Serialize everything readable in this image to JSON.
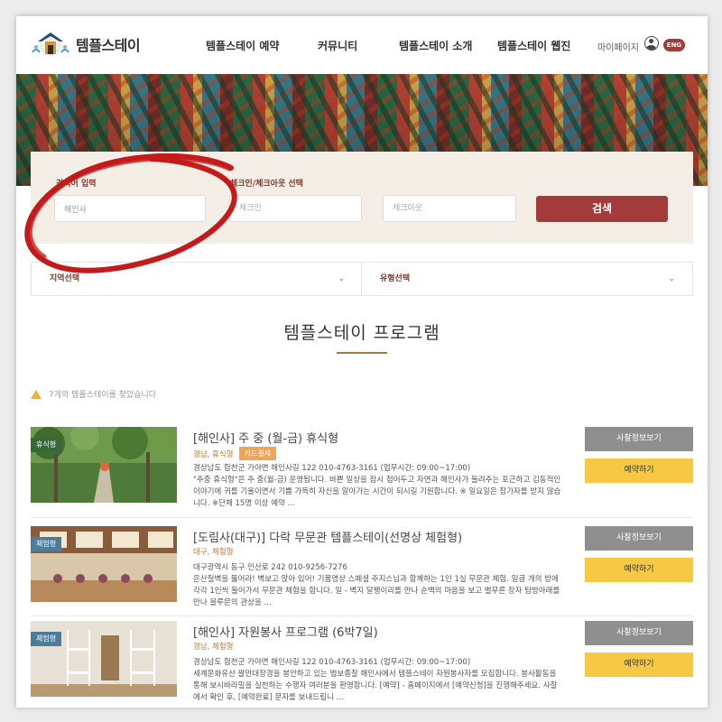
{
  "header": {
    "logo_text": "템플스테이",
    "nav": [
      "템플스테이 예약",
      "커뮤니티",
      "템플스테이 소개",
      "템플스테이 웹진"
    ],
    "mypage": "마이페이지",
    "lang": "ENG"
  },
  "search": {
    "keyword_label": "검색어 입력",
    "keyword_value": "해인사",
    "date_label": "체크인/체크아웃 선택",
    "checkin_placeholder": "체크인",
    "checkout_placeholder": "체크아웃",
    "button": "검색"
  },
  "filters": {
    "region": "지역선택",
    "type": "유형선택"
  },
  "section_title": "템플스테이 프로그램",
  "notice": "7개의 템플스테이를 찾았습니다",
  "programs": [
    {
      "tag": "휴식형",
      "title": "[해인사] 주 중 (월-금) 휴식형",
      "meta": "경남, 휴식형",
      "badge": "카드결제",
      "address": "경상남도 합천군 가야면 해인사길 122 010-4763-3161 (업무시간: 09:00~17:00)",
      "desc": "\"주중 휴식형\"은 주 중(월-금) 운영됩니다. 바쁜 일상을 잠시 접어두고 자연과 해인사가 들려주는 포근하고 김동적인 이야기에 귀를 기울이면서 기쁨 가득히 자신을 알아가는 시간이 되시길 기원합니다. ※ 일요일은 참가자를 받지 않습니다. ※단체 15명 이상 예약 ...",
      "info_btn": "사찰정보보기",
      "book_btn": "예약하기"
    },
    {
      "tag": "체험형",
      "title": "[도림사(대구)] 다락 무문관 템플스테이(선명상 체험형)",
      "meta": "대구, 체험형",
      "badge": "",
      "address": "대구광역시 동구 인산로 242 010-9256-7276",
      "desc": "은산철벽을 뚫어라! 벽보고 앉아 있어! 기몸명상 스페셜 주지스님과 함께하는 1인 1실 무문관 체험. 일곱 개의 방에 각각 1인씩 들어가서 무문관 체험을 합니다. 일 - 벽지 달팽이리를 만나 순백의 마음을 보고 별무른 장자 탐방아래를 만나 블루문의 관상을 ...",
      "info_btn": "사찰정보보기",
      "book_btn": "예약하기"
    },
    {
      "tag": "체험형",
      "title": "[해인사] 자원봉사 프로그램 (6박7일)",
      "meta": "경남, 체험형",
      "badge": "",
      "address": "경상남도 합천군 가야면 해인사길 122 010-4763-3161 (업무시간: 09:00~17:00)",
      "desc": "세계문화유산 팔만대장경을 봉안하고 있는 법보종찰 해인사에서 템플스테이 자원봉사자를 모집합니다. 봉사활동을 통해 보시바라밀을 실천하는 수행자 여러분을 환영합니다. [예약] - 홈페이지에서 [예약신청]을 진행해주세요. 사찰에서 확인 후, [예약완료] 문자를 보내드립니 ...",
      "info_btn": "사찰정보보기",
      "book_btn": "예약하기"
    }
  ],
  "colors": {
    "brand_red": "#a33b3b",
    "label_brown": "#7a3a2e",
    "book_yellow": "#f6c844",
    "info_gray": "#8f8f8f",
    "panel_beige": "#f5eee6"
  }
}
